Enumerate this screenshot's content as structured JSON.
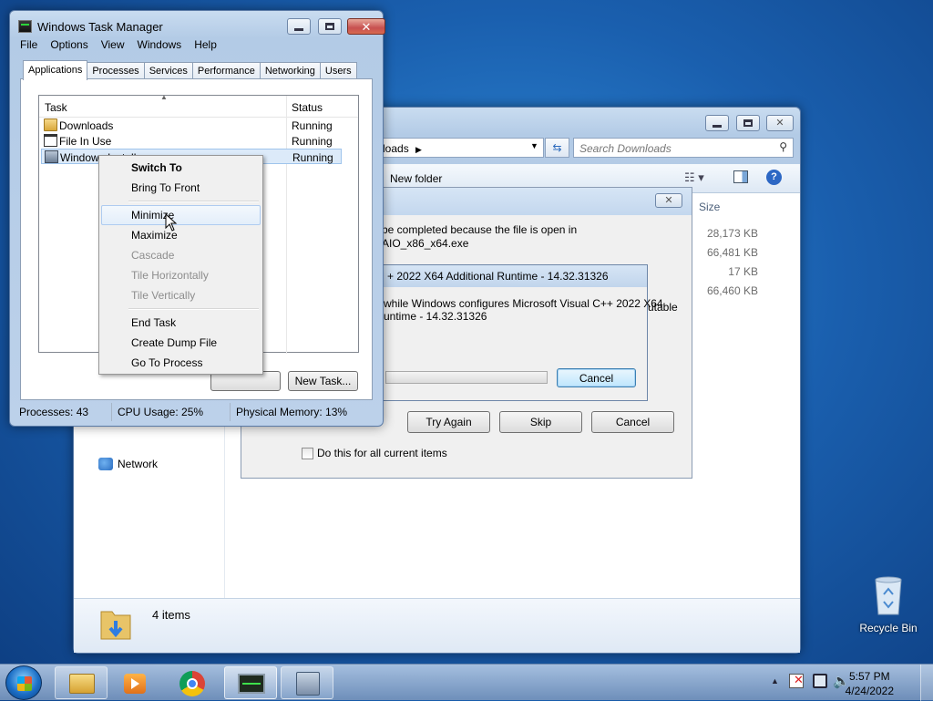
{
  "explorer": {
    "address": "loads",
    "search_placeholder": "Search Downloads",
    "new_folder": "New folder",
    "size_header": "Size",
    "sizes": [
      "28,173 KB",
      "66,481 KB",
      "17 KB",
      "66,460 KB"
    ],
    "nav_network": "Network",
    "items_count": "4 items"
  },
  "file_in_use": {
    "message_line1": "be completed because the file is open in",
    "message_line2": "AIO_x86_x64.exe",
    "side_text": "utable",
    "try_again": "Try Again",
    "skip": "Skip",
    "cancel": "Cancel",
    "checkbox_label": "Do this for all current items"
  },
  "vc_dialog": {
    "title": "+ 2022 X64 Additional Runtime - 14.32.31326",
    "message_line1": "while Windows configures Microsoft Visual C++ 2022 X64",
    "message_line2": "untime - 14.32.31326",
    "cancel": "Cancel",
    "progress": 0.0
  },
  "task_manager": {
    "title": "Windows Task Manager",
    "menu": [
      "File",
      "Options",
      "View",
      "Windows",
      "Help"
    ],
    "tabs": [
      "Applications",
      "Processes",
      "Services",
      "Performance",
      "Networking",
      "Users"
    ],
    "columns": {
      "task": "Task",
      "status": "Status"
    },
    "rows": [
      {
        "task": "Downloads",
        "status": "Running"
      },
      {
        "task": "File In Use",
        "status": "Running"
      },
      {
        "task": "Windows Installer",
        "status": "Running"
      }
    ],
    "new_task": "New Task...",
    "status": {
      "processes": "Processes: 43",
      "cpu": "CPU Usage: 25%",
      "memory": "Physical Memory: 13%"
    }
  },
  "context_menu": {
    "switch_to": "Switch To",
    "bring_to_front": "Bring To Front",
    "minimize": "Minimize",
    "maximize": "Maximize",
    "cascade": "Cascade",
    "tile_h": "Tile Horizontally",
    "tile_v": "Tile Vertically",
    "end_task": "End Task",
    "create_dump": "Create Dump File",
    "go_to_process": "Go To Process"
  },
  "desktop": {
    "recycle_bin": "Recycle Bin"
  },
  "taskbar": {
    "time": "5:57 PM",
    "date": "4/24/2022",
    "icons": [
      "start-orb-icon",
      "explorer-icon",
      "media-player-icon",
      "chrome-icon",
      "task-manager-icon",
      "installer-icon"
    ]
  }
}
